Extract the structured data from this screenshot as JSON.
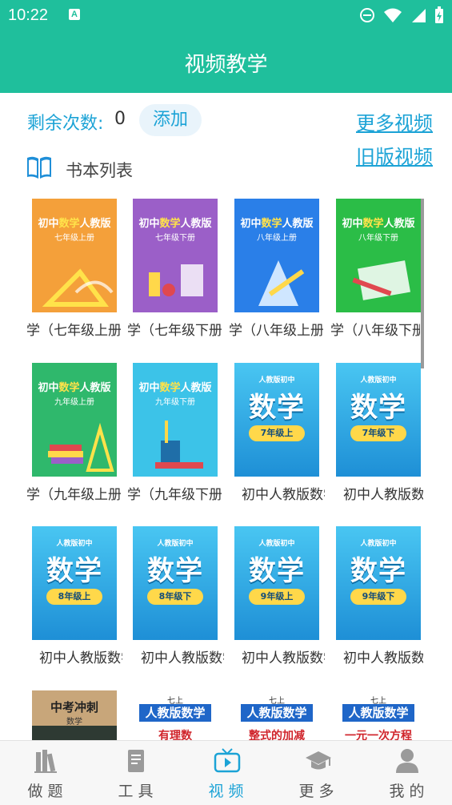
{
  "status": {
    "time": "10:22",
    "a_badge": "A"
  },
  "header": {
    "title": "视频教学"
  },
  "top": {
    "remain_label": "剩余次数:",
    "remain_count": "0",
    "add_label": "添加",
    "more_videos": "更多视频",
    "old_videos": "旧版视频"
  },
  "section": {
    "label": "书本列表"
  },
  "books": [
    {
      "caption": "学（七年级上册",
      "cover_pre": "初中",
      "cover_hl": "数学",
      "cover_post": "人教版",
      "grade": "七年级上册",
      "color": "#f4a03a"
    },
    {
      "caption": "学（七年级下册",
      "cover_pre": "初中",
      "cover_hl": "数学",
      "cover_post": "人教版",
      "grade": "七年级下册",
      "color": "#9b5fc8"
    },
    {
      "caption": "学（八年级上册",
      "cover_pre": "初中",
      "cover_hl": "数学",
      "cover_post": "人教版",
      "grade": "八年级上册",
      "color": "#2a7fe8"
    },
    {
      "caption": "学（八年级下册",
      "cover_pre": "初中",
      "cover_hl": "数学",
      "cover_post": "人教版",
      "grade": "八年级下册",
      "color": "#2bbd47"
    },
    {
      "caption": "学（九年级上册",
      "cover_pre": "初中",
      "cover_hl": "数学",
      "cover_post": "人教版",
      "grade": "九年级上册",
      "color": "#2fb86c"
    },
    {
      "caption": "学（九年级下册",
      "cover_pre": "初中",
      "cover_hl": "数学",
      "cover_post": "人教版",
      "grade": "九年级下册",
      "color": "#3cc3e8"
    },
    {
      "caption": "初中人教版数学",
      "small": "人教版初中",
      "big": "数学",
      "pill": "7年级上"
    },
    {
      "caption": "初中人教版数学",
      "small": "人教版初中",
      "big": "数学",
      "pill": "7年级下"
    },
    {
      "caption": "初中人教版数学",
      "small": "人教版初中",
      "big": "数学",
      "pill": "8年级上"
    },
    {
      "caption": "初中人教版数学",
      "small": "人教版初中",
      "big": "数学",
      "pill": "8年级下"
    },
    {
      "caption": "初中人教版数学",
      "small": "人教版初中",
      "big": "数学",
      "pill": "9年级上"
    },
    {
      "caption": "初中人教版数学",
      "small": "人教版初中",
      "big": "数学",
      "pill": "9年级下"
    }
  ],
  "row4": [
    {
      "title": "中考冲刺",
      "sub": "数学"
    },
    {
      "top": "七上",
      "title": "人教版数学",
      "sub": "有理数"
    },
    {
      "top": "七上",
      "title": "人教版数学",
      "sub": "整式的加减"
    },
    {
      "top": "七上",
      "title": "人教版数学",
      "sub": "一元一次方程"
    }
  ],
  "nav": [
    {
      "label": "做题",
      "icon": "books-icon"
    },
    {
      "label": "工具",
      "icon": "document-icon"
    },
    {
      "label": "视频",
      "icon": "tv-play-icon"
    },
    {
      "label": "更多",
      "icon": "graduation-cap-icon"
    },
    {
      "label": "我的",
      "icon": "person-icon"
    }
  ],
  "colors": {
    "accent": "#1fbf9c",
    "link": "#1ca3d6",
    "pill": "#ffd84a",
    "blue_cover": "#2aa8e8"
  }
}
